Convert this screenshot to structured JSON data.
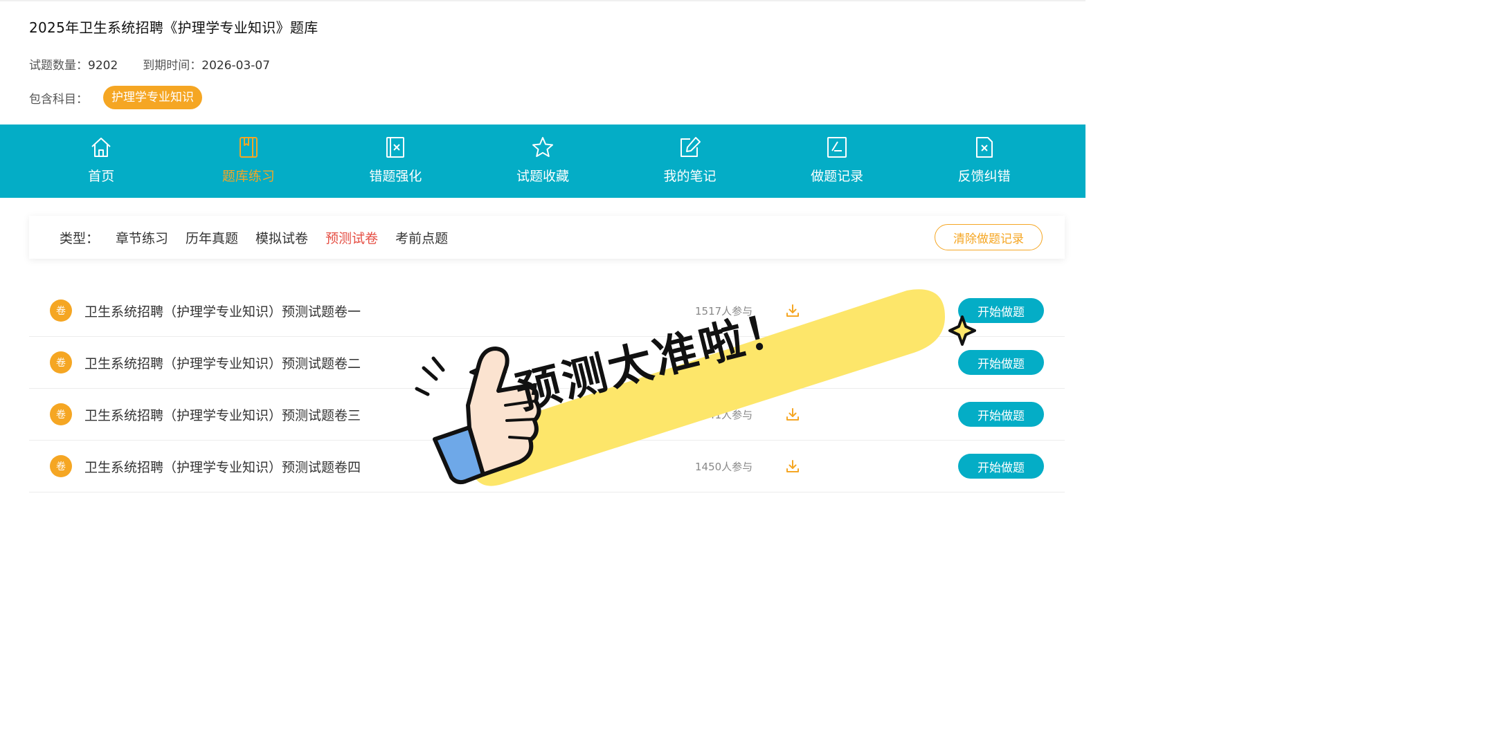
{
  "header": {
    "title": "2025年卫生系统招聘《护理学专业知识》题库",
    "question_count_label": "试题数量：",
    "question_count": "9202",
    "expiry_label": "到期时间：",
    "expiry": "2026-03-07",
    "subject_label": "包含科目：",
    "subject_tag": "护理学专业知识"
  },
  "nav": {
    "items": [
      {
        "label": "首页",
        "icon": "home-icon"
      },
      {
        "label": "题库练习",
        "icon": "book-icon"
      },
      {
        "label": "错题强化",
        "icon": "wrong-book-icon"
      },
      {
        "label": "试题收藏",
        "icon": "star-icon"
      },
      {
        "label": "我的笔记",
        "icon": "edit-note-icon"
      },
      {
        "label": "做题记录",
        "icon": "record-icon"
      },
      {
        "label": "反馈纠错",
        "icon": "feedback-icon"
      }
    ],
    "active_index": 1
  },
  "filter": {
    "type_label": "类型：",
    "options": [
      "章节练习",
      "历年真题",
      "模拟试卷",
      "预测试卷",
      "考前点题"
    ],
    "active_index": 3,
    "clear_label": "清除做题记录"
  },
  "papers": [
    {
      "badge": "卷",
      "name": "卫生系统招聘（护理学专业知识）预测试题卷一",
      "count": "1517人参与",
      "action": "开始做题"
    },
    {
      "badge": "卷",
      "name": "卫生系统招聘（护理学专业知识）预测试题卷二",
      "count": "",
      "action": "开始做题"
    },
    {
      "badge": "卷",
      "name": "卫生系统招聘（护理学专业知识）预测试题卷三",
      "count": "1341人参与",
      "action": "开始做题"
    },
    {
      "badge": "卷",
      "name": "卫生系统招聘（护理学专业知识）预测试题卷四",
      "count": "1450人参与",
      "action": "开始做题"
    }
  ],
  "sticker": {
    "text": "预测太准啦！"
  },
  "colors": {
    "accent": "#04adc6",
    "orange": "#f5a623",
    "active_red": "#e54d42",
    "sticker_yellow": "#fde66a"
  }
}
